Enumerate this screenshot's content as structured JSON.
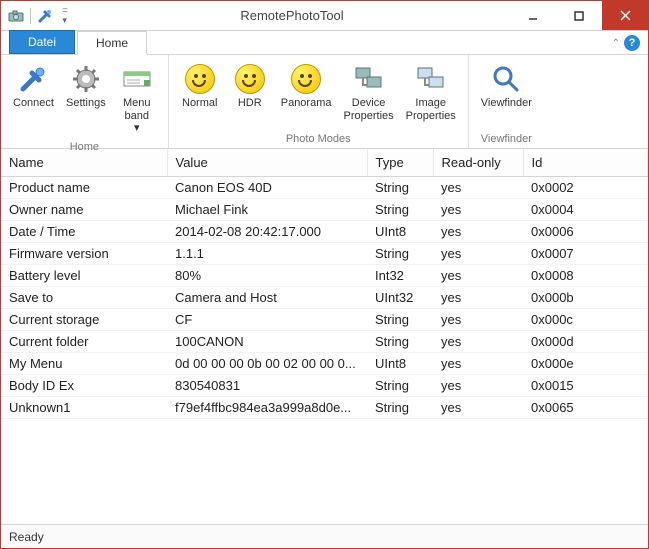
{
  "window": {
    "title": "RemotePhotoTool"
  },
  "tabs": {
    "file": "Datei",
    "home": "Home"
  },
  "ribbon": {
    "home": {
      "label": "Home",
      "connect": "Connect",
      "settings": "Settings",
      "menuband": "Menu band"
    },
    "photomodes": {
      "label": "Photo Modes",
      "normal": "Normal",
      "hdr": "HDR",
      "panorama": "Panorama",
      "devprops": "Device Properties",
      "imgprops": "Image Properties"
    },
    "viewfinder": {
      "label": "Viewfinder",
      "viewfinder": "Viewfinder"
    }
  },
  "columns": {
    "name": "Name",
    "value": "Value",
    "type": "Type",
    "readonly": "Read-only",
    "id": "Id"
  },
  "rows": [
    {
      "name": "Product name",
      "value": "Canon EOS 40D",
      "type": "String",
      "readonly": "yes",
      "id": "0x0002"
    },
    {
      "name": "Owner name",
      "value": "Michael Fink",
      "type": "String",
      "readonly": "yes",
      "id": "0x0004"
    },
    {
      "name": "Date / Time",
      "value": "2014-02-08 20:42:17.000",
      "type": "UInt8",
      "readonly": "yes",
      "id": "0x0006"
    },
    {
      "name": "Firmware version",
      "value": "1.1.1",
      "type": "String",
      "readonly": "yes",
      "id": "0x0007"
    },
    {
      "name": "Battery level",
      "value": "80%",
      "type": "Int32",
      "readonly": "yes",
      "id": "0x0008"
    },
    {
      "name": "Save to",
      "value": "Camera and Host",
      "type": "UInt32",
      "readonly": "yes",
      "id": "0x000b"
    },
    {
      "name": "Current storage",
      "value": "CF",
      "type": "String",
      "readonly": "yes",
      "id": "0x000c"
    },
    {
      "name": "Current folder",
      "value": "100CANON",
      "type": "String",
      "readonly": "yes",
      "id": "0x000d"
    },
    {
      "name": "My Menu",
      "value": "0d 00 00 00 0b 00 02 00 00 0...",
      "type": "UInt8",
      "readonly": "yes",
      "id": "0x000e"
    },
    {
      "name": "Body ID Ex",
      "value": "830540831",
      "type": "String",
      "readonly": "yes",
      "id": "0x0015"
    },
    {
      "name": "Unknown1",
      "value": "f79ef4ffbc984ea3a999a8d0e...",
      "type": "String",
      "readonly": "yes",
      "id": "0x0065"
    }
  ],
  "status": {
    "text": "Ready"
  }
}
